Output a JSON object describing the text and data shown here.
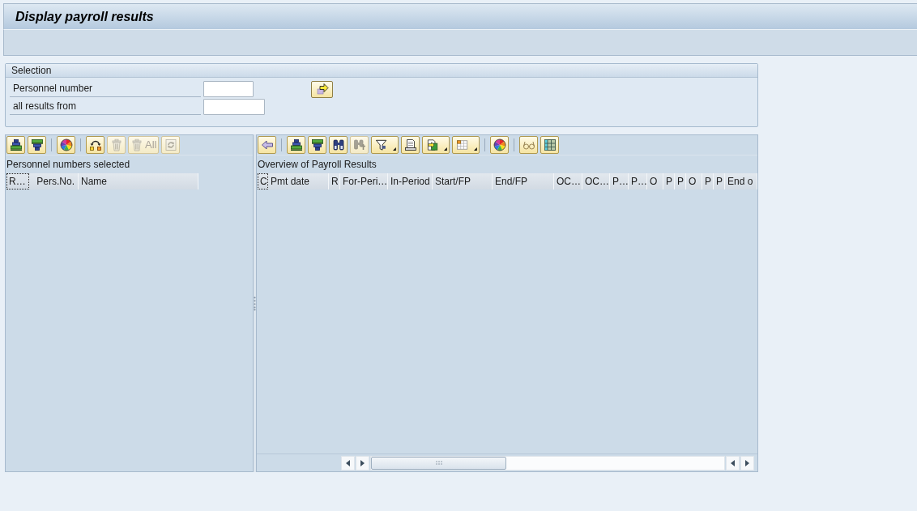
{
  "window": {
    "title": "Display payroll results"
  },
  "selection": {
    "title": "Selection",
    "fields": [
      {
        "label": "Personnel number"
      },
      {
        "label": "all results from"
      }
    ]
  },
  "left_panel": {
    "toolbar": [
      {
        "kind": "button",
        "disabled": false
      },
      {
        "kind": "button",
        "disabled": false
      },
      {
        "kind": "separator"
      },
      {
        "kind": "button",
        "disabled": false
      },
      {
        "kind": "separator"
      },
      {
        "kind": "button",
        "disabled": false
      },
      {
        "kind": "button",
        "disabled": true
      },
      {
        "kind": "button",
        "label": "All",
        "disabled": true
      },
      {
        "kind": "button",
        "disabled": true
      }
    ],
    "title": "Personnel numbers selected",
    "columns": [
      {
        "label": "R…",
        "focused": true
      },
      {
        "label": "Pers.No.",
        "focused": false
      },
      {
        "label": "Name",
        "focused": false
      }
    ]
  },
  "right_panel": {
    "toolbar": [
      {
        "kind": "button",
        "disabled": false
      },
      {
        "kind": "separator"
      },
      {
        "kind": "button",
        "disabled": false
      },
      {
        "kind": "button",
        "disabled": false
      },
      {
        "kind": "button",
        "disabled": false
      },
      {
        "kind": "button",
        "disabled": true
      },
      {
        "kind": "menu",
        "disabled": false
      },
      {
        "kind": "button",
        "disabled": false
      },
      {
        "kind": "menu",
        "disabled": false
      },
      {
        "kind": "menu",
        "disabled": false
      },
      {
        "kind": "separator"
      },
      {
        "kind": "button",
        "disabled": false
      },
      {
        "kind": "separator"
      },
      {
        "kind": "button",
        "disabled": false
      },
      {
        "kind": "button",
        "disabled": false
      }
    ],
    "title": "Overview of Payroll Results",
    "columns": [
      {
        "label": "C",
        "focused": true
      },
      {
        "label": "Pmt date",
        "focused": false
      },
      {
        "label": "R",
        "focused": false
      },
      {
        "label": "For-Peri…",
        "focused": false
      },
      {
        "label": "In-Period",
        "focused": false
      },
      {
        "label": "Start/FP",
        "focused": false
      },
      {
        "label": "End/FP",
        "focused": false
      },
      {
        "label": "OC…",
        "focused": false
      },
      {
        "label": "OC…",
        "focused": false
      },
      {
        "label": "P…",
        "focused": false
      },
      {
        "label": "P…",
        "focused": false
      },
      {
        "label": "O",
        "focused": false
      },
      {
        "label": "P",
        "focused": false
      },
      {
        "label": "P",
        "focused": false
      },
      {
        "label": "O",
        "focused": false
      },
      {
        "label": "P",
        "focused": false
      },
      {
        "label": "P",
        "focused": false
      },
      {
        "label": "End o",
        "focused": false
      }
    ]
  }
}
